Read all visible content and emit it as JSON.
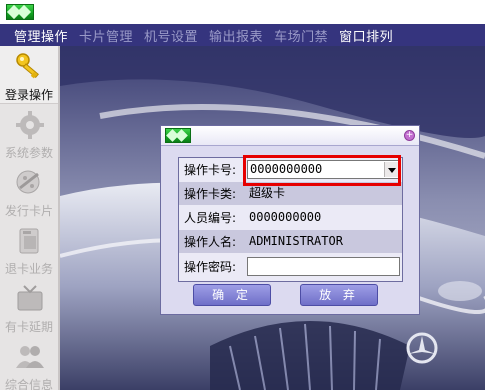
{
  "menu": {
    "items": [
      {
        "label": "管理操作",
        "active": true
      },
      {
        "label": "卡片管理",
        "active": false
      },
      {
        "label": "机号设置",
        "active": false
      },
      {
        "label": "输出报表",
        "active": false
      },
      {
        "label": "车场门禁",
        "active": false
      },
      {
        "label": "窗口排列",
        "active": true
      }
    ]
  },
  "toolbar": {
    "items": [
      {
        "label": "登录操作",
        "icon": "key-icon",
        "active": true
      },
      {
        "label": "系统参数",
        "icon": "gear-icon",
        "active": false
      },
      {
        "label": "发行卡片",
        "icon": "card-issue-icon",
        "active": false
      },
      {
        "label": "退卡业务",
        "icon": "card-return-icon",
        "active": false
      },
      {
        "label": "有卡延期",
        "icon": "tv-icon",
        "active": false
      },
      {
        "label": "综合信息",
        "icon": "users-icon",
        "active": false
      }
    ]
  },
  "dialog": {
    "fields": [
      {
        "label": "操作卡号:",
        "value": "0000000000"
      },
      {
        "label": "操作卡类:",
        "value": "超级卡"
      },
      {
        "label": "人员编号:",
        "value": "0000000000"
      },
      {
        "label": "操作人名:",
        "value": "ADMINISTRATOR"
      },
      {
        "label": "操作密码:",
        "value": ""
      }
    ],
    "ok_label": "确 定",
    "cancel_label": "放 弃"
  },
  "colors": {
    "menubar": "#35347e",
    "highlight": "#e60000",
    "button": "#7c7cd2"
  }
}
